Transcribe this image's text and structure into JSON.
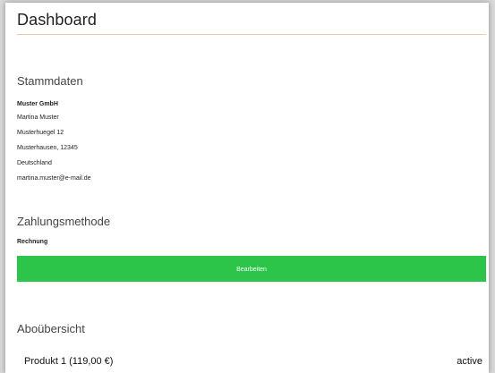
{
  "header": {
    "title": "Dashboard"
  },
  "stammdaten": {
    "heading": "Stammdaten",
    "company": "Muster GmbH",
    "name": "Martina Muster",
    "street": "Musterhuegel 12",
    "city": "Musterhausen, 12345",
    "country": "Deutschland",
    "email": "martina.muster@e-mail.de"
  },
  "zahlung": {
    "heading": "Zahlungsmethode",
    "method": "Rechnung",
    "edit_label": "Bearbeiten"
  },
  "abo": {
    "heading": "Aboübersicht",
    "items": [
      {
        "name": "Produkt 1 (119,00 €)",
        "status": "active"
      }
    ]
  },
  "colors": {
    "accent_button": "#2dc44a",
    "title_rule": "#f2c9a8"
  }
}
